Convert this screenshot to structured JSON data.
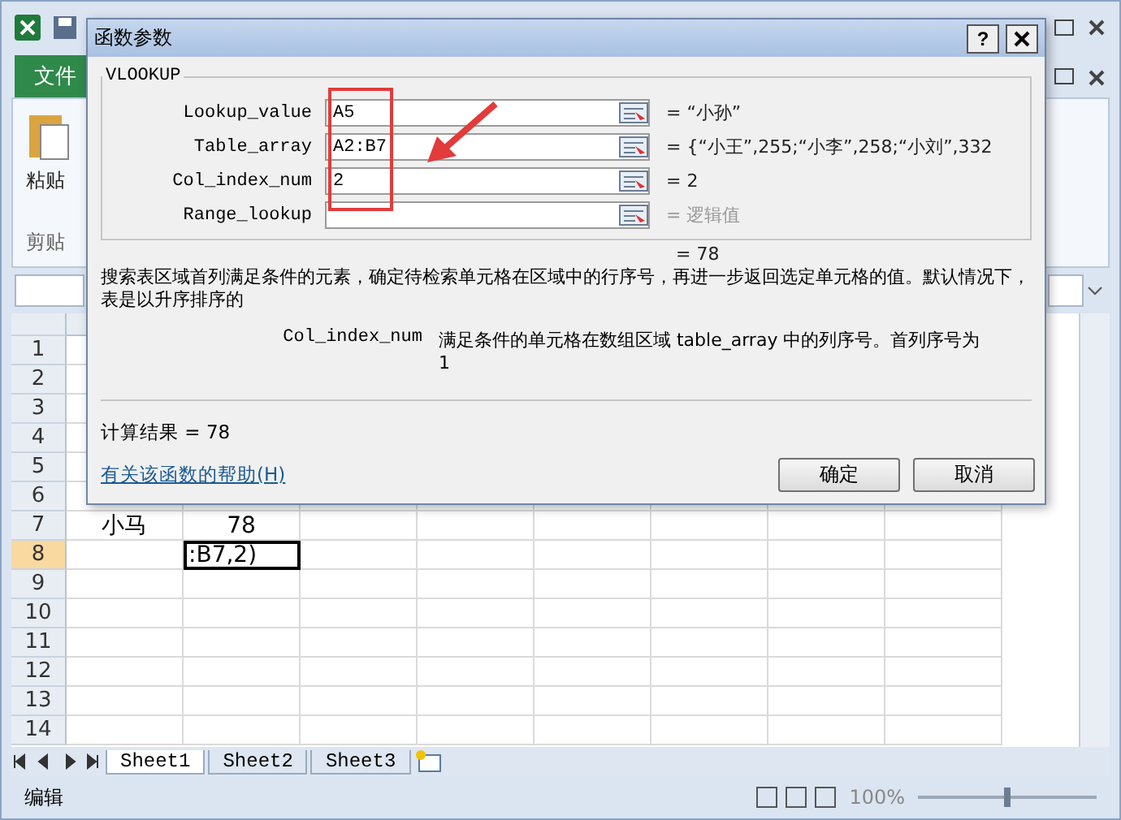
{
  "excel": {
    "file_tab": "文件",
    "paste_label": "粘贴",
    "clipboard_group": "剪贴",
    "rows": [
      {
        "number": "1",
        "selected": false
      },
      {
        "number": "2",
        "selected": false
      },
      {
        "number": "3",
        "selected": false
      },
      {
        "number": "4",
        "selected": false
      },
      {
        "number": "5",
        "selected": false
      },
      {
        "number": "6",
        "selected": false
      },
      {
        "number": "7",
        "selected": false,
        "col_a": "小马",
        "col_b": "78"
      },
      {
        "number": "8",
        "selected": true,
        "col_b": ":B7,2)"
      },
      {
        "number": "9",
        "selected": false
      },
      {
        "number": "10",
        "selected": false
      },
      {
        "number": "11",
        "selected": false
      },
      {
        "number": "12",
        "selected": false
      },
      {
        "number": "13",
        "selected": false
      },
      {
        "number": "14",
        "selected": false
      }
    ],
    "sheets": [
      {
        "label": "Sheet1",
        "selected": true
      },
      {
        "label": "Sheet2",
        "selected": false
      },
      {
        "label": "Sheet3",
        "selected": false
      }
    ],
    "status": "编辑",
    "zoom": {
      "reading": "100%",
      "level": 0.5
    }
  },
  "dialog": {
    "title": "函数参数",
    "help_button": "?",
    "group": "VLOOKUP",
    "arguments": [
      {
        "label": "Lookup_value",
        "value": "A5",
        "result": "= “小孙”",
        "muted": false
      },
      {
        "label": "Table_array",
        "value": "A2:B7",
        "result": "= {“小王”,255;“小李”,258;“小刘”,332",
        "muted": false
      },
      {
        "label": "Col_index_num",
        "value": "2",
        "result": "= 2",
        "muted": false
      },
      {
        "label": "Range_lookup",
        "result": "= 逻辑值",
        "muted": true
      }
    ],
    "total": "= 78",
    "description": "搜索表区域首列满足条件的元素，确定待检索单元格在区域中的行序号，再进一步返回选定单元格的值。默认情况下，表是以升序排序的",
    "arg_name": "Col_index_num",
    "arg_help": "满足条件的单元格在数组区域 table_array 中的列序号。首列序号为 1",
    "result": "计算结果 = 78",
    "help_link": "有关该函数的帮助(H)",
    "buttons": [
      "确定",
      "取消"
    ]
  }
}
